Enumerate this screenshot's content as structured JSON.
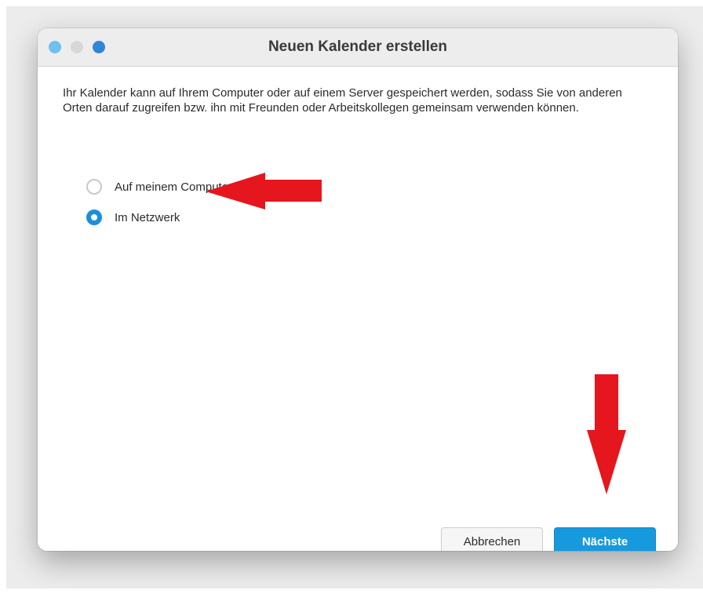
{
  "window": {
    "title": "Neuen Kalender erstellen",
    "traffic_lights": [
      "close-dot",
      "minimize-dot",
      "zoom-dot"
    ]
  },
  "dialog": {
    "description": "Ihr Kalender kann auf Ihrem Computer oder auf einem Server gespeichert werden, sodass Sie von anderen Orten darauf zugreifen bzw. ihn mit Freunden oder Arbeitskollegen gemeinsam verwenden können.",
    "options": [
      {
        "label": "Auf meinem Computer",
        "selected": false
      },
      {
        "label": "Im Netzwerk",
        "selected": true
      }
    ]
  },
  "buttons": {
    "cancel_label": "Abbrechen",
    "next_label": "Nächste"
  },
  "annotations": {
    "arrow_color": "#e5161d",
    "arrows": [
      "left-pointing-arrow-to-network-option",
      "down-pointing-arrow-to-next-button"
    ]
  },
  "colors": {
    "accent": "#1799dd",
    "radio_selected": "#1a8fdc"
  }
}
